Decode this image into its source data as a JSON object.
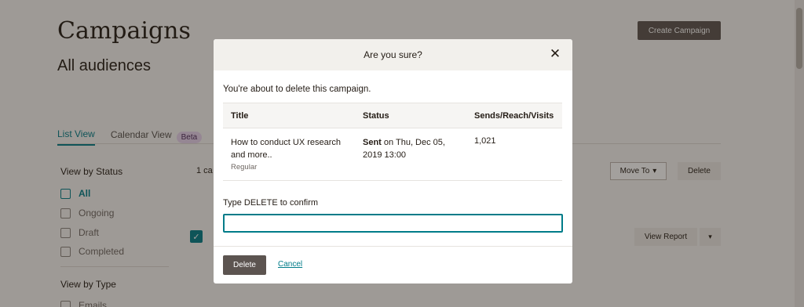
{
  "page": {
    "title": "Campaigns",
    "subtitle": "All audiences",
    "create_button": "Create Campaign",
    "tabs": [
      {
        "label": "List View",
        "active": true
      },
      {
        "label": "Calendar View"
      }
    ],
    "beta_badge": "Beta",
    "sidebar": {
      "status_heading": "View by Status",
      "status_items": [
        {
          "label": "All",
          "icon": "mail-open-icon",
          "active": true
        },
        {
          "label": "Ongoing",
          "icon": "ongoing-icon"
        },
        {
          "label": "Draft",
          "icon": "draft-icon"
        },
        {
          "label": "Completed",
          "icon": "check-badge-icon"
        }
      ],
      "type_heading": "View by Type",
      "type_items": [
        {
          "label": "Emails",
          "icon": "email-icon"
        }
      ]
    },
    "count_text": "1 ca",
    "move_to": "Move To",
    "delete": "Delete",
    "view_report": "View Report",
    "accent": "#007c89"
  },
  "modal": {
    "title": "Are you sure?",
    "close_icon": "close-icon",
    "lead": "You're about to delete this campaign.",
    "table": {
      "headers": [
        "Title",
        "Status",
        "Sends/Reach/Visits"
      ],
      "row": {
        "title": "How to conduct UX research and more..",
        "type": "Regular",
        "status_bold": "Sent",
        "status_rest": " on Thu, Dec 05, 2019 13:00",
        "sends": "1,021"
      }
    },
    "confirm_label": "Type DELETE to confirm",
    "confirm_value": "",
    "delete_button": "Delete",
    "cancel_link": "Cancel"
  }
}
